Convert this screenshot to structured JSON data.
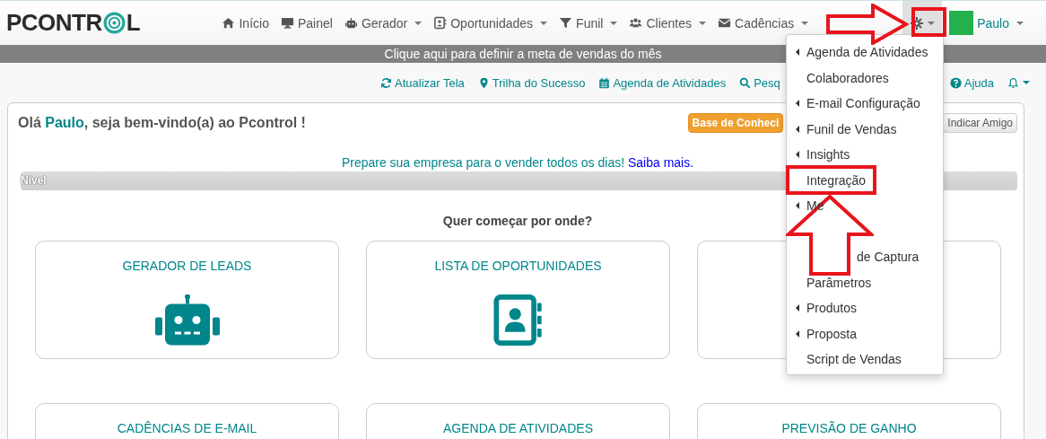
{
  "logo": {
    "before": "PCONTR",
    "after": "L"
  },
  "nav": [
    {
      "label": "Início",
      "dropdown": false
    },
    {
      "label": "Painel",
      "dropdown": false
    },
    {
      "label": "Gerador",
      "dropdown": true
    },
    {
      "label": "Oportunidades",
      "dropdown": true
    },
    {
      "label": "Funil",
      "dropdown": true
    },
    {
      "label": "Clientes",
      "dropdown": true
    },
    {
      "label": "Cadências",
      "dropdown": true
    }
  ],
  "settings": {
    "expanded": true
  },
  "user": {
    "name": "Paulo",
    "color": "#22b14c"
  },
  "banner": "Clique aqui para definir a meta de vendas do mês",
  "toolbar": [
    {
      "label": "Atualizar Tela"
    },
    {
      "label": "Trilha do Sucesso"
    },
    {
      "label": "Agenda de Atividades"
    },
    {
      "label": "Pesq"
    }
  ],
  "toolbar_right": [
    {
      "label": "Ajuda"
    }
  ],
  "greeting": {
    "prefix": "Olá ",
    "name": "Paulo",
    "suffix": ", seja bem-vindo(a) ao Pcontrol !"
  },
  "buttons": [
    {
      "label": "Base de Conheci",
      "kind": "warning"
    },
    {
      "label": "Indicar Amigo",
      "kind": "default"
    }
  ],
  "promo": {
    "text": "Prepare sua empresa para o vender todos os dias!",
    "link": "Saiba mais."
  },
  "progress": {
    "label": "Nível",
    "level": 0
  },
  "question": "Quer começar por onde?",
  "tiles": [
    {
      "kind": "titled",
      "title": "GERADOR DE LEADS"
    },
    {
      "kind": "titled",
      "title": "LISTA DE OPORTUNIDADES"
    },
    {
      "kind": "blank"
    },
    {
      "kind": "titled",
      "title": "CADÊNCIAS DE E-MAIL"
    },
    {
      "kind": "titled",
      "title": "AGENDA DE ATIVIDADES"
    },
    {
      "kind": "titled",
      "title": "PREVISÃO DE GANHO"
    }
  ],
  "menu": [
    {
      "label": "Agenda de Atividades",
      "submenu": true,
      "kind": "item"
    },
    {
      "label": "Colaboradores",
      "submenu": false,
      "kind": "item"
    },
    {
      "label": "E-mail Configuração",
      "submenu": true,
      "kind": "item"
    },
    {
      "label": "Funil de Vendas",
      "submenu": true,
      "kind": "item"
    },
    {
      "label": "Insights",
      "submenu": true,
      "kind": "item"
    },
    {
      "label": "Integração",
      "submenu": false,
      "kind": "item"
    },
    {
      "label": "Me",
      "submenu": true,
      "kind": "item"
    },
    {
      "label": "de Captura",
      "submenu": false,
      "kind": "partial"
    },
    {
      "label": "Parâmetros",
      "submenu": false,
      "kind": "item"
    },
    {
      "label": "Produtos",
      "submenu": true,
      "kind": "item"
    },
    {
      "label": "Proposta",
      "submenu": true,
      "kind": "item"
    },
    {
      "label": "Script de Vendas",
      "submenu": false,
      "kind": "item"
    }
  ]
}
